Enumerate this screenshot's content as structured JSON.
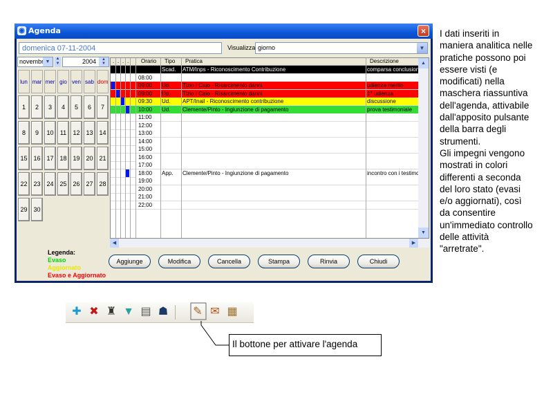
{
  "window": {
    "title": "Agenda",
    "close_symbol": "×"
  },
  "header": {
    "date": "domenica 07-11-2004",
    "view_label": "Visualizza",
    "view_value": "giorno"
  },
  "calendar": {
    "month": "novembre",
    "year": "2004",
    "weekdays": [
      "lun",
      "mar",
      "mer",
      "gio",
      "ven",
      "sab",
      "dom"
    ],
    "weeks": [
      [
        "1",
        "2",
        "3",
        "4",
        "5",
        "6",
        "7"
      ],
      [
        "8",
        "9",
        "10",
        "11",
        "12",
        "13",
        "14"
      ],
      [
        "15",
        "16",
        "17",
        "18",
        "19",
        "20",
        "21"
      ],
      [
        "22",
        "23",
        "24",
        "25",
        "26",
        "27",
        "28"
      ],
      [
        "29",
        "30",
        "",
        "",
        "",
        "",
        ""
      ]
    ]
  },
  "grid": {
    "columns": {
      "check1": ".",
      "check2": ".",
      "check3": ".",
      "check4": ".",
      "orario": "Orario",
      "tipo": "Tipo",
      "pratica": "Pratica",
      "descrizione": "Descrizione"
    },
    "rows": [
      {
        "orario": "",
        "tipo": "Scad.",
        "pratica": "ATM/Inps - Riconoscimento Contribuzione",
        "descrizione": "comparsa conclusionale",
        "bg": "#000000",
        "fg": "#ffffff",
        "mark": -1
      },
      {
        "orario": "08:00",
        "tipo": "",
        "pratica": "",
        "descrizione": "",
        "bg": "#ffffff",
        "fg": "#000000",
        "mark": -1
      },
      {
        "orario": "09:00",
        "tipo": "Ud.",
        "pratica": "Tizio / Caio - Risarcimento danni",
        "descrizione": "udienza merito",
        "bg": "#ff0000",
        "fg": "#000000",
        "mark": 0
      },
      {
        "orario": "09:00",
        "tipo": "Ud.",
        "pratica": "Tizio / Caio - Risarcimento danni",
        "descrizione": "1° udienza",
        "bg": "#ff0000",
        "fg": "#000000",
        "mark": 1
      },
      {
        "orario": "09:30",
        "tipo": "Ud.",
        "pratica": "APT/Inail - Riconoscimento contribuzione",
        "descrizione": "discussione",
        "bg": "#ffff00",
        "fg": "#000000",
        "mark": 2
      },
      {
        "orario": "10:00",
        "tipo": "Ud.",
        "pratica": "Clemente/Pinto - Ingiunzione di pagamento",
        "descrizione": "prova testimoniale",
        "bg": "#33dd33",
        "fg": "#000000",
        "mark": 3
      },
      {
        "orario": "11:00",
        "tipo": "",
        "pratica": "",
        "descrizione": "",
        "bg": "#ffffff",
        "fg": "#000000",
        "mark": -1
      },
      {
        "orario": "12:00",
        "tipo": "",
        "pratica": "",
        "descrizione": "",
        "bg": "#ffffff",
        "fg": "#000000",
        "mark": -1
      },
      {
        "orario": "13:00",
        "tipo": "",
        "pratica": "",
        "descrizione": "",
        "bg": "#ffffff",
        "fg": "#000000",
        "mark": -1
      },
      {
        "orario": "14:00",
        "tipo": "",
        "pratica": "",
        "descrizione": "",
        "bg": "#ffffff",
        "fg": "#000000",
        "mark": -1
      },
      {
        "orario": "15:00",
        "tipo": "",
        "pratica": "",
        "descrizione": "",
        "bg": "#ffffff",
        "fg": "#000000",
        "mark": -1
      },
      {
        "orario": "16:00",
        "tipo": "",
        "pratica": "",
        "descrizione": "",
        "bg": "#ffffff",
        "fg": "#000000",
        "mark": -1
      },
      {
        "orario": "17:00",
        "tipo": "",
        "pratica": "",
        "descrizione": "",
        "bg": "#ffffff",
        "fg": "#000000",
        "mark": -1
      },
      {
        "orario": "18:00",
        "tipo": "App.",
        "pratica": "Clemente/Pinto - Ingiunzione di pagamento",
        "descrizione": "incontro con i testimoni",
        "bg": "#ffffff",
        "fg": "#000000",
        "mark": 3
      },
      {
        "orario": "19:00",
        "tipo": "",
        "pratica": "",
        "descrizione": "",
        "bg": "#ffffff",
        "fg": "#000000",
        "mark": -1
      },
      {
        "orario": "20:00",
        "tipo": "",
        "pratica": "",
        "descrizione": "",
        "bg": "#ffffff",
        "fg": "#000000",
        "mark": -1
      },
      {
        "orario": "21:00",
        "tipo": "",
        "pratica": "",
        "descrizione": "",
        "bg": "#ffffff",
        "fg": "#000000",
        "mark": -1
      },
      {
        "orario": "22:00",
        "tipo": "",
        "pratica": "",
        "descrizione": "",
        "bg": "#ffffff",
        "fg": "#000000",
        "mark": -1
      }
    ]
  },
  "legend": {
    "title": "Legenda:",
    "evaso": "Evaso",
    "aggiornato": "Aggiornato",
    "evaso_aggiornato": "Evaso e Aggiornato",
    "colors": {
      "evaso": "#00dd00",
      "aggiornato": "#ffff00",
      "evaso_aggiornato": "#ff0000"
    }
  },
  "buttons": {
    "aggiunge": "Aggiunge",
    "modifica": "Modifica",
    "cancella": "Cancella",
    "stampa": "Stampa",
    "rinvia": "Rinvia",
    "chiudi": "Chiudi"
  },
  "side_text": [
    "I dati inseriti in",
    "maniera analitica nelle",
    "pratiche possono poi",
    "essere visti (e",
    "modificati) nella",
    "maschera riassuntiva",
    "dell'agenda, attivabile",
    "dall'apposito pulsante",
    "della barra degli",
    "strumenti.",
    "Gli impegni vengono",
    "mostrati in colori",
    "differenti a seconda",
    "del loro stato (evasi",
    "e/o aggiornati), così",
    "da consentire",
    "un'immediato controllo",
    "delle attività",
    "\"arretrate\"."
  ],
  "toolbar": {
    "icons": [
      {
        "name": "add-icon",
        "glyph": "✚",
        "color": "#1a9bd7"
      },
      {
        "name": "delete-icon",
        "glyph": "✖",
        "color": "#c01818"
      },
      {
        "name": "binoculars-icon",
        "glyph": "♜",
        "color": "#333333"
      },
      {
        "name": "filter-icon",
        "glyph": "▼",
        "color": "#2aa0a0"
      },
      {
        "name": "printer-icon",
        "glyph": "▤",
        "color": "#555555"
      },
      {
        "name": "user-icon",
        "glyph": "☗",
        "color": "#1a3a6a"
      },
      {
        "name": "agenda-icon",
        "glyph": "✎",
        "color": "#a06020"
      },
      {
        "name": "mail-icon",
        "glyph": "✉",
        "color": "#c05010"
      },
      {
        "name": "archive-icon",
        "glyph": "▦",
        "color": "#a07030"
      }
    ]
  },
  "callout": {
    "text": "Il bottone per attivare l'agenda"
  }
}
